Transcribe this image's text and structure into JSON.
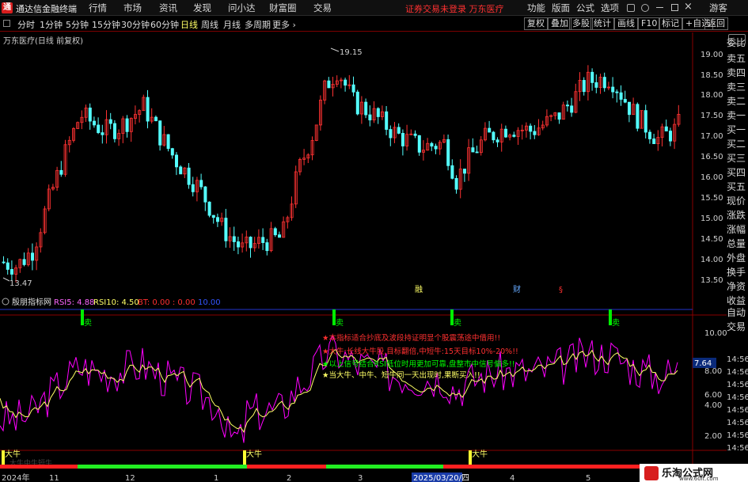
{
  "app": {
    "logo": "通",
    "title": "通达信金融终端",
    "menus": [
      "行情",
      "市场",
      "资讯",
      "发现",
      "问小达",
      "财富圈",
      "交易"
    ],
    "promo": "证券交易未登录",
    "stock_name": "万东医疗",
    "right_menus": [
      "功能",
      "版面",
      "公式",
      "选项"
    ],
    "guest": "游客"
  },
  "toolbar": {
    "periods": [
      "分时",
      "1分钟",
      "5分钟",
      "15分钟",
      "30分钟",
      "60分钟",
      "日线",
      "周线",
      "月线",
      "多周期",
      "更多"
    ],
    "active": "日线",
    "buttons": [
      "复权",
      "叠加",
      "多股",
      "统计",
      "画线",
      "F10",
      "标记",
      "+自选",
      "返回"
    ]
  },
  "main_chart": {
    "title": "万东医疗(日线 前复权)",
    "high_label": "19.15",
    "low_label": "13.47",
    "yaxis": [
      "19.00",
      "18.50",
      "18.00",
      "17.50",
      "17.00",
      "16.50",
      "16.00",
      "15.50",
      "15.00",
      "14.50",
      "14.00",
      "13.50"
    ],
    "markers": [
      "融",
      "财",
      "§"
    ]
  },
  "indicator": {
    "name": "殷朋指标网",
    "rsi5": "RSI5: 4.88",
    "rsi10": "RSI10: 4.50",
    "bt": "BT: 0.00 : 0.00",
    "ten": "10.00",
    "yaxis": [
      "10.00",
      "8.00",
      "6.00",
      "4.00",
      "2.00"
    ],
    "value_tag": "7.64",
    "sell": "卖",
    "bull": "大牛",
    "notes": [
      "★本指标适合抄底及波段持证明显个股震荡途中借用!!",
      "★大牛:长线大牛股,目标翻倍,中短牛:15天目标10%-20%!!",
      "★以上信号结合RSI低位时用更加可靠,盘整市中信号偏多!!",
      "★当大牛、中牛、短牛同一天出现时,果断买入!!"
    ],
    "bottom_text": "大牛中牛短牛"
  },
  "xaxis": {
    "year": "2024年",
    "months": [
      "11",
      "12",
      "1",
      "2",
      "3",
      "4",
      "5",
      "6"
    ],
    "cursor_date": "2025/03/20/四"
  },
  "right_panel": [
    "委比",
    "卖五",
    "卖四",
    "卖三",
    "卖二",
    "卖一",
    "买一",
    "买二",
    "买三",
    "买四",
    "买五",
    "现价",
    "涨跌",
    "涨幅",
    "总量",
    "外盘",
    "换手",
    "净资",
    "收益"
  ],
  "right_panel_lower": [
    "自动",
    "交易"
  ],
  "time_labels": [
    "14:56",
    "14:56",
    "14:56",
    "14:56",
    "14:56",
    "14:56",
    "14:56",
    "14:56",
    "14:56",
    "14:56",
    "14:56"
  ],
  "watermark": {
    "title": "乐淘公式网",
    "url": "www.60lt.com"
  },
  "colors": {
    "up": "#ff3232",
    "down": "#54ffff",
    "accent_red": "#ff3030",
    "yellow": "#ffff66",
    "green": "#00ff00",
    "magenta": "#ff00ff"
  }
}
